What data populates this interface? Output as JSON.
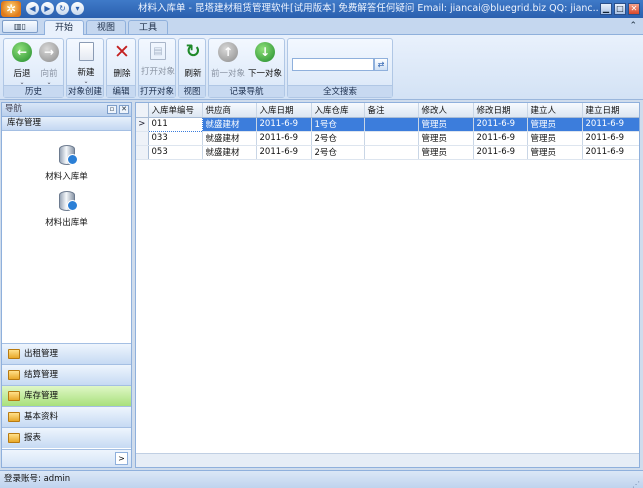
{
  "window": {
    "title": "材料入库单 - 昆塔建材租赁管理软件[试用版本] 免费解答任何疑问 Email: jiancai@bluegrid.biz QQ: jianc...",
    "buttons": [
      "▁",
      "□",
      "✕"
    ]
  },
  "ribbon": {
    "app_menu_label": "▥▯",
    "tabs": [
      {
        "label": "开始",
        "active": true
      },
      {
        "label": "视图",
        "active": false
      },
      {
        "label": "工具",
        "active": false
      }
    ],
    "expand_glyph": "⌃",
    "groups": {
      "history": {
        "label": "历史",
        "back": "后退",
        "forward": "向前"
      },
      "create": {
        "label": "对象创建",
        "new": "新建"
      },
      "edit": {
        "label": "编辑",
        "delete": "删除"
      },
      "open": {
        "label": "打开对象",
        "open": "打开对象"
      },
      "view": {
        "label": "视图",
        "refresh": "刷新"
      },
      "record_nav": {
        "label": "记录导航",
        "prev": "前一对象",
        "next": "下一对象"
      },
      "fulltext": {
        "label": "全文搜索",
        "placeholder": ""
      }
    }
  },
  "nav": {
    "header": "导航",
    "section": "库存管理",
    "items": [
      {
        "label": "材料入库单"
      },
      {
        "label": "材料出库单"
      }
    ],
    "bars": [
      {
        "label": "出租管理",
        "active": false
      },
      {
        "label": "结算管理",
        "active": false
      },
      {
        "label": "库存管理",
        "active": true
      },
      {
        "label": "基本资料",
        "active": false
      },
      {
        "label": "报表",
        "active": false
      }
    ],
    "footer_glyph": ">"
  },
  "grid": {
    "columns": [
      "入库单编号",
      "供应商",
      "入库日期",
      "入库仓库",
      "备注",
      "修改人",
      "修改日期",
      "建立人",
      "建立日期"
    ],
    "selected_marker": ">",
    "rows": [
      {
        "cells": [
          "011",
          "就盛建材",
          "2011-6-9",
          "1号仓",
          "",
          "管理员",
          "2011-6-9",
          "管理员",
          "2011-6-9"
        ],
        "selected": true
      },
      {
        "cells": [
          "033",
          "就盛建材",
          "2011-6-9",
          "2号仓",
          "",
          "管理员",
          "2011-6-9",
          "管理员",
          "2011-6-9"
        ],
        "selected": false
      },
      {
        "cells": [
          "053",
          "就盛建材",
          "2011-6-9",
          "2号仓",
          "",
          "管理员",
          "2011-6-9",
          "管理员",
          "2011-6-9"
        ],
        "selected": false
      }
    ]
  },
  "status": {
    "login": "登录账号: admin"
  }
}
